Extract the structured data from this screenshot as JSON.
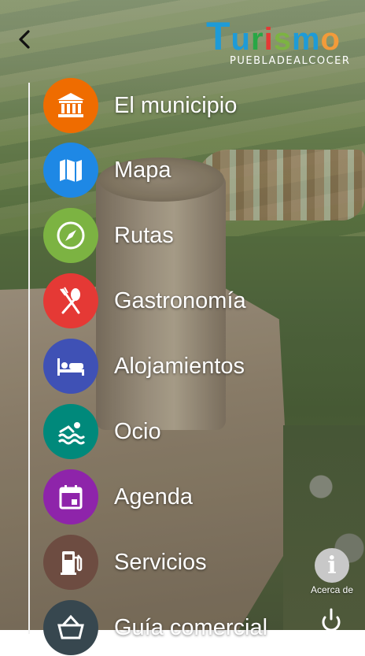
{
  "header": {
    "logo_word": [
      "T",
      "u",
      "r",
      "i",
      "s",
      "m",
      "o"
    ],
    "logo_colors": [
      "#1e9bd7",
      "#1e9bd7",
      "#28a745",
      "#e53935",
      "#7cb342",
      "#1e9bd7",
      "#f29b3a"
    ],
    "logo_sub": "PUEBLADEALCOCER",
    "back_icon": "chevron-left-icon"
  },
  "menu": {
    "items": [
      {
        "label": "El municipio",
        "icon": "bank-icon",
        "color": "#ef6c00"
      },
      {
        "label": "Mapa",
        "icon": "map-icon",
        "color": "#1e88e5"
      },
      {
        "label": "Rutas",
        "icon": "compass-icon",
        "color": "#7cb342"
      },
      {
        "label": "Gastronomía",
        "icon": "cutlery-icon",
        "color": "#e53935"
      },
      {
        "label": "Alojamientos",
        "icon": "bed-icon",
        "color": "#3f51b5"
      },
      {
        "label": "Ocio",
        "icon": "swimmer-icon",
        "color": "#00897b"
      },
      {
        "label": "Agenda",
        "icon": "calendar-icon",
        "color": "#8e24aa"
      },
      {
        "label": "Servicios",
        "icon": "fuel-pump-icon",
        "color": "#6d4c41"
      },
      {
        "label": "Guía comercial",
        "icon": "basket-icon",
        "color": "#37474f"
      }
    ]
  },
  "footer": {
    "about_label": "Acerca de",
    "about_icon": "info-icon",
    "power_icon": "power-icon"
  }
}
